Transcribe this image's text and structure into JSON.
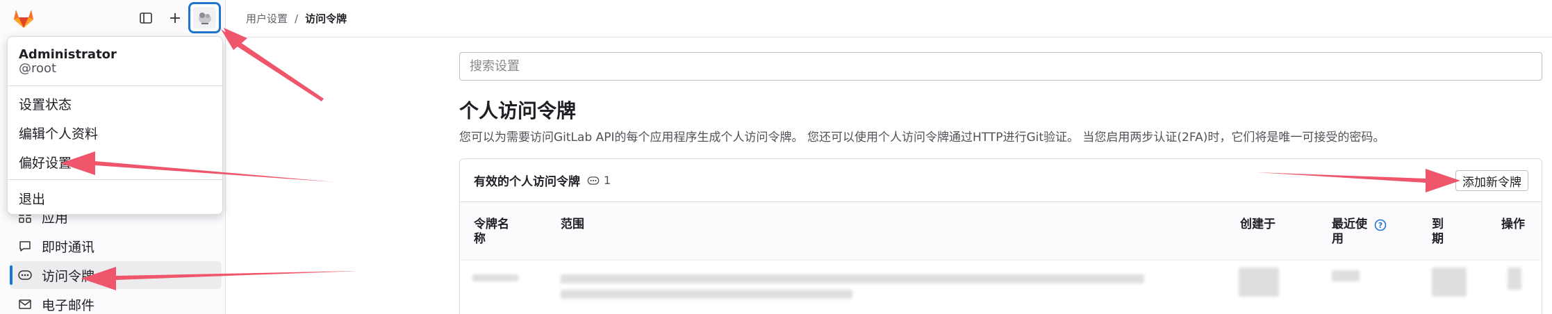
{
  "breadcrumb": {
    "parent": "用户设置",
    "separator": "/",
    "current": "访问令牌"
  },
  "user_menu": {
    "name": "Administrator",
    "username": "@root",
    "items": [
      "设置状态",
      "编辑个人资料",
      "偏好设置"
    ],
    "signout": "退出"
  },
  "sidebar": {
    "items": [
      {
        "label": "应用",
        "icon": "applications-icon"
      },
      {
        "label": "即时通讯",
        "icon": "comment-icon"
      },
      {
        "label": "访问令牌",
        "icon": "token-icon",
        "active": true
      },
      {
        "label": "电子邮件",
        "icon": "mail-icon"
      }
    ]
  },
  "search": {
    "placeholder": "搜索设置"
  },
  "page": {
    "title": "个人访问令牌",
    "description": "您可以为需要访问GitLab API的每个应用程序生成个人访问令牌。 您还可以使用个人访问令牌通过HTTP进行Git验证。 当您启用两步认证(2FA)时，它们将是唯一可接受的密码。"
  },
  "tokens_card": {
    "title": "有效的个人访问令牌",
    "count": "1",
    "add_button": "添加新令牌",
    "columns": {
      "name": [
        "令牌名",
        "称"
      ],
      "scopes": "范围",
      "created": "创建于",
      "last_used": [
        "最近使",
        "用"
      ],
      "expires": [
        "到",
        "期"
      ],
      "actions": "操作"
    }
  },
  "colors": {
    "accent": "#1f75cb",
    "arrow": "#f0566b",
    "logo_orange": "#fc6d26"
  }
}
